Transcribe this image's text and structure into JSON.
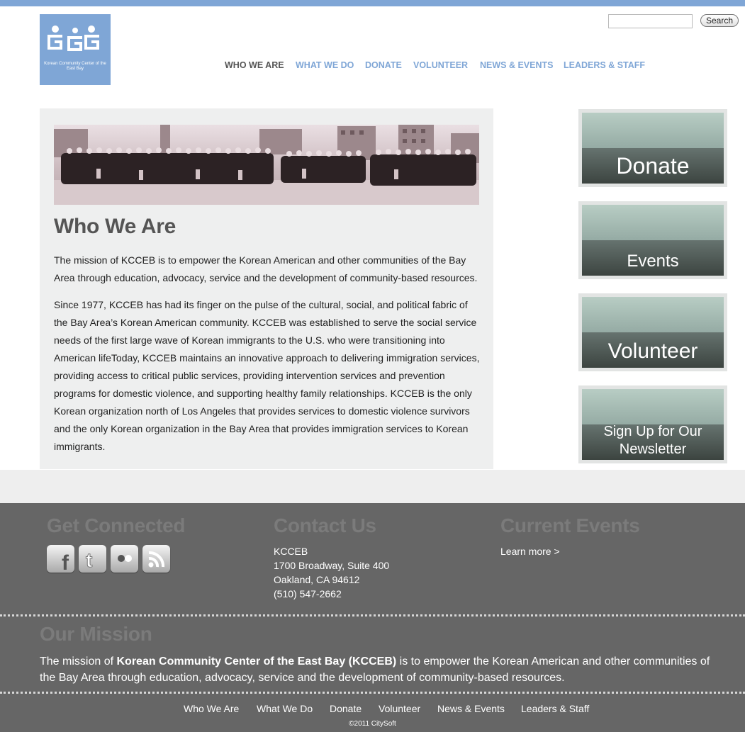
{
  "logo": {
    "text": "Korean Community Center of the East Bay"
  },
  "search": {
    "placeholder": "",
    "button_label": "Search"
  },
  "nav": {
    "items": [
      "WHO WE ARE",
      "WHAT WE DO",
      "DONATE",
      "VOLUNTEER",
      "NEWS & EVENTS",
      "LEADERS & STAFF"
    ],
    "active": "WHO WE ARE"
  },
  "main": {
    "title": "Who We Are",
    "paragraphs": [
      "The mission of KCCEB is to empower the Korean American and other communities of the Bay Area through education, advocacy, service and the development of community-based resources.",
      "Since 1977, KCCEB has had its finger on the pulse of the cultural, social, and political fabric of the Bay Area’s Korean American community. KCCEB was established to serve the social service needs of the first large wave of Korean immigrants to the U.S. who were transitioning into American lifeToday, KCCEB maintains an innovative approach to delivering immigration services, providing access to critical public services, providing intervention services and prevention programs for domestic violence, and supporting healthy family relationships. KCCEB is the only Korean organization north of Los Angeles that provides services to domestic violence survivors and the only Korean organization in the Bay Area that provides immigration services to Korean immigrants."
    ]
  },
  "sidebar": {
    "buttons": [
      "Donate",
      "Events",
      "Volunteer",
      "Sign Up for Our Newsletter"
    ]
  },
  "footer": {
    "get_connected": {
      "heading": "Get Connected",
      "icons": [
        "facebook-icon",
        "twitter-icon",
        "flickr-icon",
        "rss-icon"
      ]
    },
    "contact": {
      "heading": "Contact Us",
      "lines": [
        "KCCEB",
        "1700 Broadway, Suite 400",
        "Oakland, CA 94612",
        "(510) 547-2662"
      ]
    },
    "events": {
      "heading": "Current Events",
      "link": "Learn more >"
    },
    "mission": {
      "heading": "Our Mission",
      "prefix": "The mission of ",
      "org": "Korean Community Center of the East Bay (KCCEB)",
      "suffix": " is to empower the Korean American and other communities of the Bay Area through education, advocacy, service and the development of community-based resources."
    },
    "nav": [
      "Who We Are",
      "What We Do",
      "Donate",
      "Volunteer",
      "News & Events",
      "Leaders & Staff"
    ],
    "copyright": "©2011 CitySoft"
  },
  "colors": {
    "accent": "#7fa6d6",
    "nav_active": "#555555",
    "content_bg": "#eeefef",
    "footer_bg": "#666666",
    "footer_heading": "#7b7b7b"
  }
}
